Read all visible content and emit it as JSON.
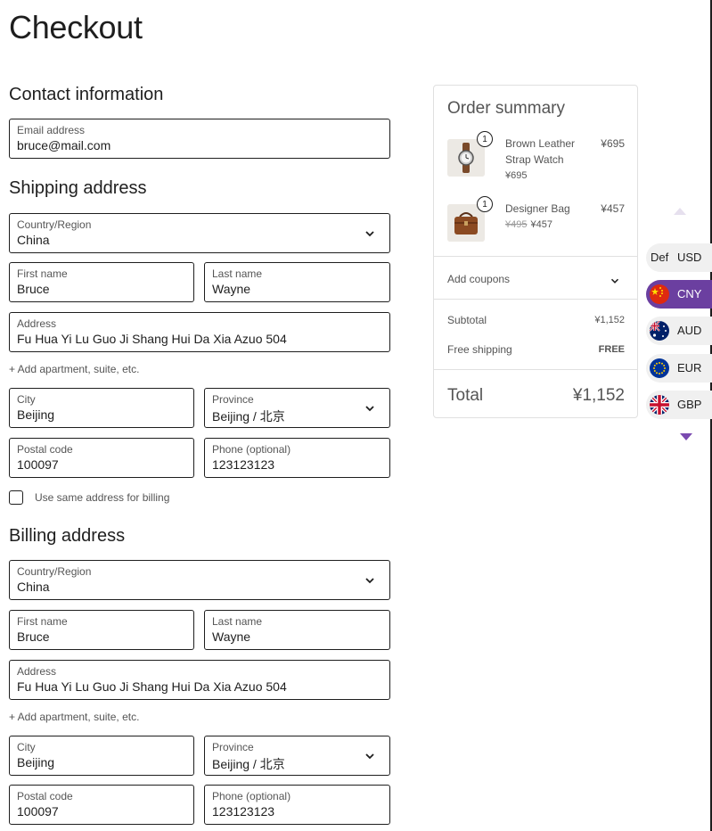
{
  "page": {
    "title": "Checkout"
  },
  "contact": {
    "heading": "Contact information",
    "email": {
      "label": "Email address",
      "value": "bruce@mail.com"
    }
  },
  "shipping": {
    "heading": "Shipping address",
    "country": {
      "label": "Country/Region",
      "value": "China"
    },
    "first_name": {
      "label": "First name",
      "value": "Bruce"
    },
    "last_name": {
      "label": "Last name",
      "value": "Wayne"
    },
    "address": {
      "label": "Address",
      "value": "Fu Hua Yi Lu Guo Ji Shang Hui Da Xia Azuo 504"
    },
    "add_apartment": "+ Add apartment, suite, etc.",
    "city": {
      "label": "City",
      "value": "Beijing"
    },
    "province": {
      "label": "Province",
      "value": "Beijing / 北京"
    },
    "postal": {
      "label": "Postal code",
      "value": "100097"
    },
    "phone": {
      "label": "Phone (optional)",
      "value": "123123123"
    },
    "same_billing_label": "Use same address for billing"
  },
  "billing": {
    "heading": "Billing address",
    "country": {
      "label": "Country/Region",
      "value": "China"
    },
    "first_name": {
      "label": "First name",
      "value": "Bruce"
    },
    "last_name": {
      "label": "Last name",
      "value": "Wayne"
    },
    "address": {
      "label": "Address",
      "value": "Fu Hua Yi Lu Guo Ji Shang Hui Da Xia Azuo 504"
    },
    "add_apartment": "+ Add apartment, suite, etc.",
    "city": {
      "label": "City",
      "value": "Beijing"
    },
    "province": {
      "label": "Province",
      "value": "Beijing / 北京"
    },
    "postal": {
      "label": "Postal code",
      "value": "100097"
    },
    "phone": {
      "label": "Phone (optional)",
      "value": "123123123"
    }
  },
  "summary": {
    "title": "Order summary",
    "items": [
      {
        "name": "Brown Leather Strap Watch",
        "qty": "1",
        "price": "¥695",
        "sub_price": "¥695",
        "old_price": ""
      },
      {
        "name": "Designer Bag",
        "qty": "1",
        "price": "¥457",
        "sub_price": "¥457",
        "old_price": "¥495"
      }
    ],
    "coupons_label": "Add coupons",
    "subtotal_label": "Subtotal",
    "subtotal_value": "¥1,152",
    "shipping_label": "Free shipping",
    "shipping_value": "FREE",
    "total_label": "Total",
    "total_value": "¥1,152"
  },
  "currency_switcher": {
    "accent": "#6b3fa0",
    "options": [
      {
        "prefix": "Def",
        "code": "USD",
        "flag": "none",
        "active": false
      },
      {
        "prefix": "",
        "code": "CNY",
        "flag": "china-flag-icon",
        "active": true
      },
      {
        "prefix": "",
        "code": "AUD",
        "flag": "australia-flag-icon",
        "active": false
      },
      {
        "prefix": "",
        "code": "EUR",
        "flag": "eu-flag-icon",
        "active": false
      },
      {
        "prefix": "",
        "code": "GBP",
        "flag": "uk-flag-icon",
        "active": false
      }
    ]
  }
}
